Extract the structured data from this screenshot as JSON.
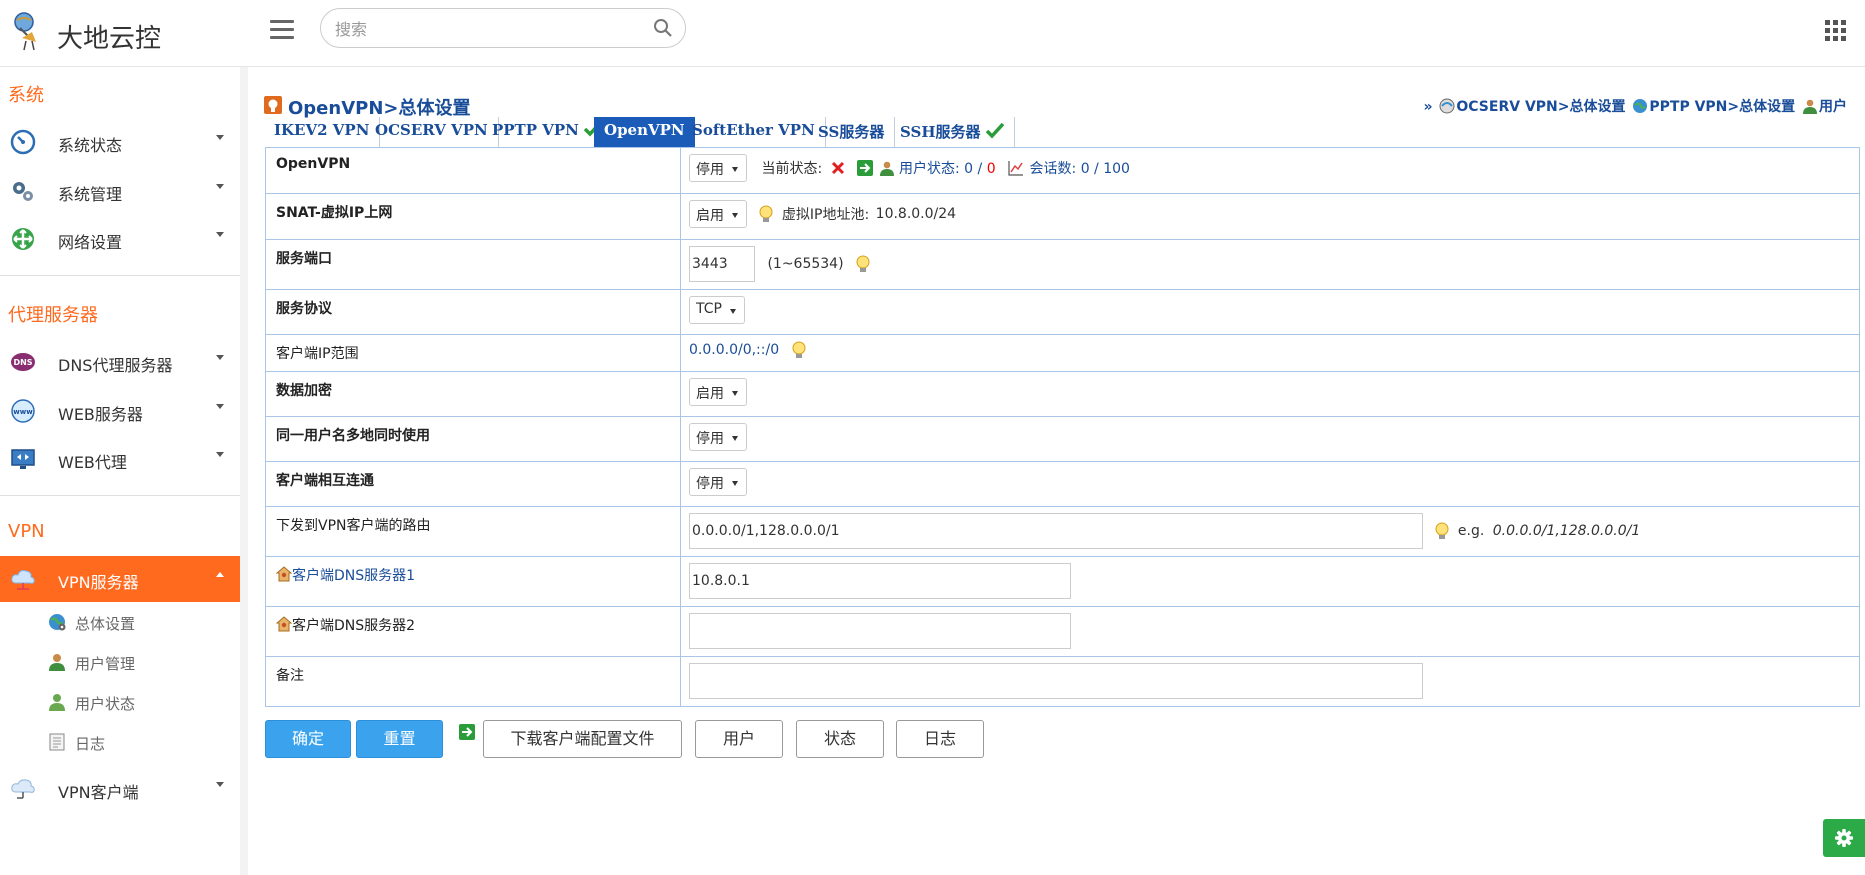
{
  "header": {
    "brand": "大地云控",
    "search_placeholder": "搜索"
  },
  "sidebar": {
    "sections": [
      {
        "title": "系统"
      },
      {
        "title": "代理服务器"
      },
      {
        "title": "VPN"
      }
    ],
    "items": [
      {
        "label": "系统状态"
      },
      {
        "label": "系统管理"
      },
      {
        "label": "网络设置"
      },
      {
        "label": "DNS代理服务器"
      },
      {
        "label": "WEB服务器"
      },
      {
        "label": "WEB代理"
      },
      {
        "label": "VPN服务器"
      },
      {
        "label": "VPN客户端"
      }
    ],
    "sub_items": [
      {
        "label": "总体设置"
      },
      {
        "label": "用户管理"
      },
      {
        "label": "用户状态"
      },
      {
        "label": "日志"
      }
    ]
  },
  "main": {
    "title": "OpenVPN>总体设置",
    "quick_links": {
      "arrow": "»",
      "ocserv": "OCSERV VPN>总体设置",
      "pptp": "PPTP VPN>总体设置",
      "user": "用户"
    },
    "tabs": [
      {
        "label": "IKEV2 VPN"
      },
      {
        "label": "OCSERV VPN"
      },
      {
        "label": "PPTP VPN"
      },
      {
        "label": "OpenVPN"
      },
      {
        "label": "SoftEther VPN"
      },
      {
        "label": "SS服务器"
      },
      {
        "label": "SSH服务器"
      }
    ],
    "rows": {
      "openvpn": {
        "label": "OpenVPN",
        "value": "停用",
        "status_label": "当前状态:",
        "user_status_label": "用户状态:",
        "users_online": "0",
        "users_sep": "/",
        "users_total": "0",
        "sessions_label": "会话数:",
        "sessions": "0 / 100"
      },
      "snat": {
        "label": "SNAT-虚拟IP上网",
        "value": "启用",
        "pool_label": "虚拟IP地址池:",
        "pool": "10.8.0.0/24"
      },
      "port": {
        "label": "服务端口",
        "value": "3443",
        "range": "(1~65534)"
      },
      "protocol": {
        "label": "服务协议",
        "value": "TCP"
      },
      "client_ip": {
        "label": "客户端IP范围",
        "value": "0.0.0.0/0,::/0"
      },
      "encryption": {
        "label": "数据加密",
        "value": "启用"
      },
      "multi_login": {
        "label": "同一用户名多地同时使用",
        "value": "停用"
      },
      "client_to_client": {
        "label": "客户端相互连通",
        "value": "停用"
      },
      "routes": {
        "label": "下发到VPN客户端的路由",
        "value": "0.0.0.0/1,128.0.0.0/1",
        "example_prefix": "e.g.",
        "example": "0.0.0.0/1,128.0.0.0/1"
      },
      "dns1": {
        "label": "客户端DNS服务器1",
        "value": "10.8.0.1"
      },
      "dns2": {
        "label": "客户端DNS服务器2",
        "value": ""
      },
      "remark": {
        "label": "备注",
        "value": ""
      }
    },
    "buttons": {
      "confirm": "确定",
      "reset": "重置",
      "download": "下载客户端配置文件",
      "users": "用户",
      "status": "状态",
      "log": "日志"
    }
  },
  "colors": {
    "accent": "#ff6a1f",
    "link": "#1a4d99",
    "primary_button": "#3ba3ee",
    "active_tab": "#1a5cb8",
    "fab": "#2daa48"
  }
}
